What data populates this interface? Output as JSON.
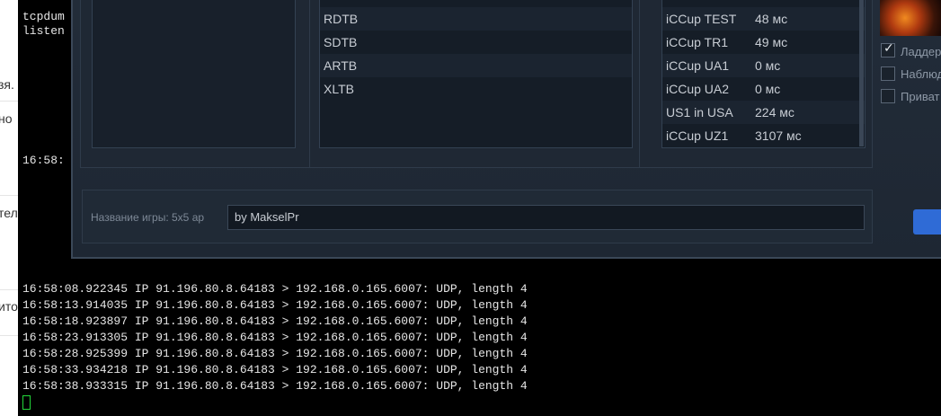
{
  "background_page": {
    "fragments": [
      "зя.",
      "но",
      "тел",
      "ито"
    ]
  },
  "terminal": {
    "top_lines": [
      "tcpdum",
      "listen"
    ],
    "partial_time": "16:58:",
    "log_lines": [
      "16:58:08.922345 IP 91.196.80.8.64183 > 192.168.0.165.6007: UDP, length 4",
      "16:58:13.914035 IP 91.196.80.8.64183 > 192.168.0.165.6007: UDP, length 4",
      "16:58:18.923897 IP 91.196.80.8.64183 > 192.168.0.165.6007: UDP, length 4",
      "16:58:23.913305 IP 91.196.80.8.64183 > 192.168.0.165.6007: UDP, length 4",
      "16:58:28.925399 IP 91.196.80.8.64183 > 192.168.0.165.6007: UDP, length 4",
      "16:58:33.934218 IP 91.196.80.8.64183 > 192.168.0.165.6007: UDP, length 4",
      "16:58:38.933315 IP 91.196.80.8.64183 > 192.168.0.165.6007: UDP, length 4"
    ],
    "cursor_color": "#23d83a"
  },
  "client": {
    "maps": [
      "RDTB",
      "SDTB",
      "ARTB",
      "XLTB"
    ],
    "servers": [
      {
        "name": "iCCup TEST",
        "ping": "48 мс"
      },
      {
        "name": "iCCup TR1",
        "ping": "49 мс"
      },
      {
        "name": "iCCup UA1",
        "ping": "0 мс"
      },
      {
        "name": "iCCup UA2",
        "ping": "0 мс"
      },
      {
        "name": "US1 in USA",
        "ping": "224 мс"
      },
      {
        "name": "iCCup UZ1",
        "ping": "3107 мс"
      }
    ],
    "options": [
      {
        "label": "Ладдер",
        "checked": true
      },
      {
        "label": "Наблюд",
        "checked": false
      },
      {
        "label": "Приват",
        "checked": false
      }
    ],
    "game_name_label": "Название игры:  5x5  ap",
    "game_name_value": "by MakselPr",
    "accent_color": "#2f6bd6"
  }
}
